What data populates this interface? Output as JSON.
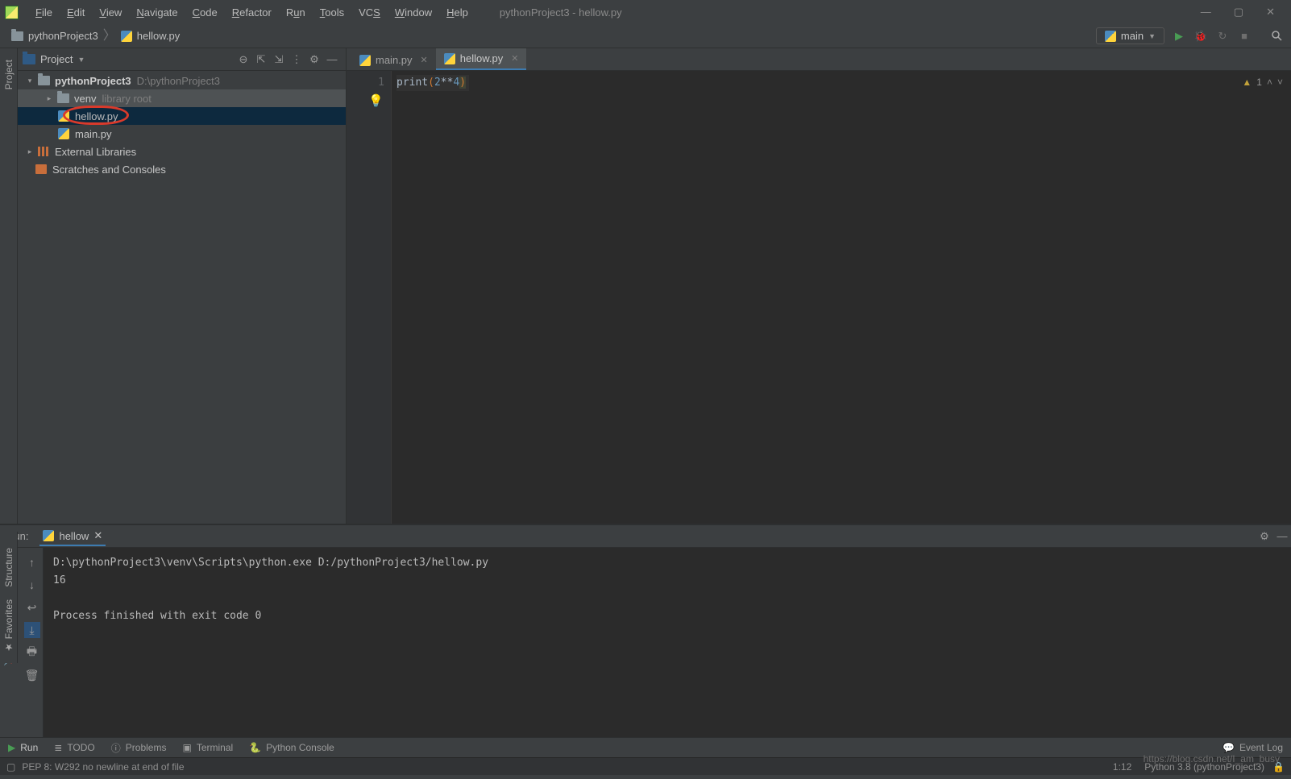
{
  "window": {
    "title": "pythonProject3 - hellow.py"
  },
  "menu": [
    "File",
    "Edit",
    "View",
    "Navigate",
    "Code",
    "Refactor",
    "Run",
    "Tools",
    "VCS",
    "Window",
    "Help"
  ],
  "breadcrumb": {
    "root": "pythonProject3",
    "file": "hellow.py"
  },
  "run_config": {
    "label": "main"
  },
  "sidebar": {
    "tabs": [
      "Project",
      "Structure",
      "Favorites"
    ]
  },
  "project": {
    "title": "Project",
    "root": {
      "name": "pythonProject3",
      "path": "D:\\pythonProject3"
    },
    "venv": {
      "name": "venv",
      "hint": "library root"
    },
    "files": [
      "hellow.py",
      "main.py"
    ],
    "ext_lib": "External Libraries",
    "scratch": "Scratches and Consoles"
  },
  "editor": {
    "tabs": [
      {
        "name": "main.py"
      },
      {
        "name": "hellow.py",
        "active": true
      }
    ],
    "line_no": "1",
    "code": {
      "fn": "print",
      "open": "(",
      "n1": "2",
      "op": "**",
      "n2": "4",
      "close": ")"
    },
    "warn_count": "1"
  },
  "run": {
    "label": "Run:",
    "tab": "hellow",
    "lines": [
      "D:\\pythonProject3\\venv\\Scripts\\python.exe D:/pythonProject3/hellow.py",
      "16",
      "",
      "Process finished with exit code 0"
    ]
  },
  "bottom": {
    "run": "Run",
    "todo": "TODO",
    "problems": "Problems",
    "terminal": "Terminal",
    "pyconsole": "Python Console",
    "eventlog": "Event Log"
  },
  "status": {
    "pep": "PEP 8: W292 no newline at end of file",
    "pos": "1:12",
    "interp": "Python 3.8 (pythonProject3)",
    "watermark": "https://blog.csdn.net/I_am_busy"
  }
}
